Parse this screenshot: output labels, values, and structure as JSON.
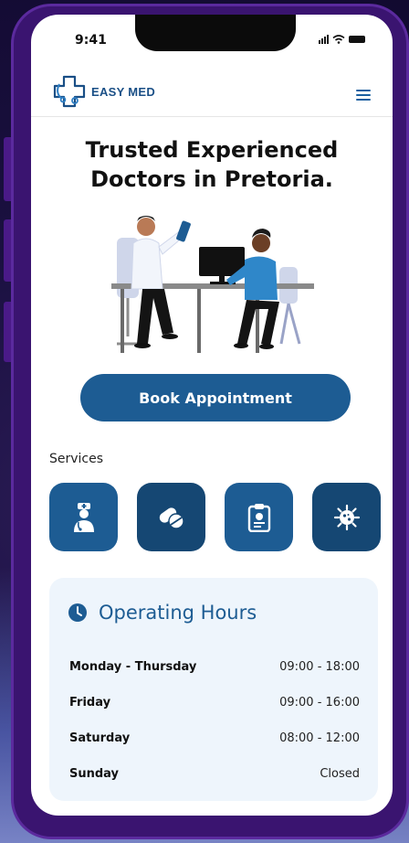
{
  "status": {
    "time": "9:41"
  },
  "header": {
    "brand": "EASY MED"
  },
  "hero": {
    "line1": "Trusted Experienced",
    "line2": "Doctors in Pretoria."
  },
  "cta": {
    "label": "Book Appointment"
  },
  "services": {
    "label": "Services",
    "items": [
      {
        "icon": "doctor-icon"
      },
      {
        "icon": "pills-icon"
      },
      {
        "icon": "clipboard-icon"
      },
      {
        "icon": "virus-icon"
      }
    ]
  },
  "hours": {
    "title": "Operating Hours",
    "rows": [
      {
        "day": "Monday - Thursday",
        "time": "09:00 - 18:00"
      },
      {
        "day": "Friday",
        "time": "09:00 - 16:00"
      },
      {
        "day": "Saturday",
        "time": "08:00 - 12:00"
      },
      {
        "day": "Sunday",
        "time": "Closed"
      }
    ]
  },
  "colors": {
    "primary": "#1d5c93",
    "primary_dark": "#154773",
    "card_bg": "#eef5fc",
    "phone_frame": "#3a1470"
  }
}
